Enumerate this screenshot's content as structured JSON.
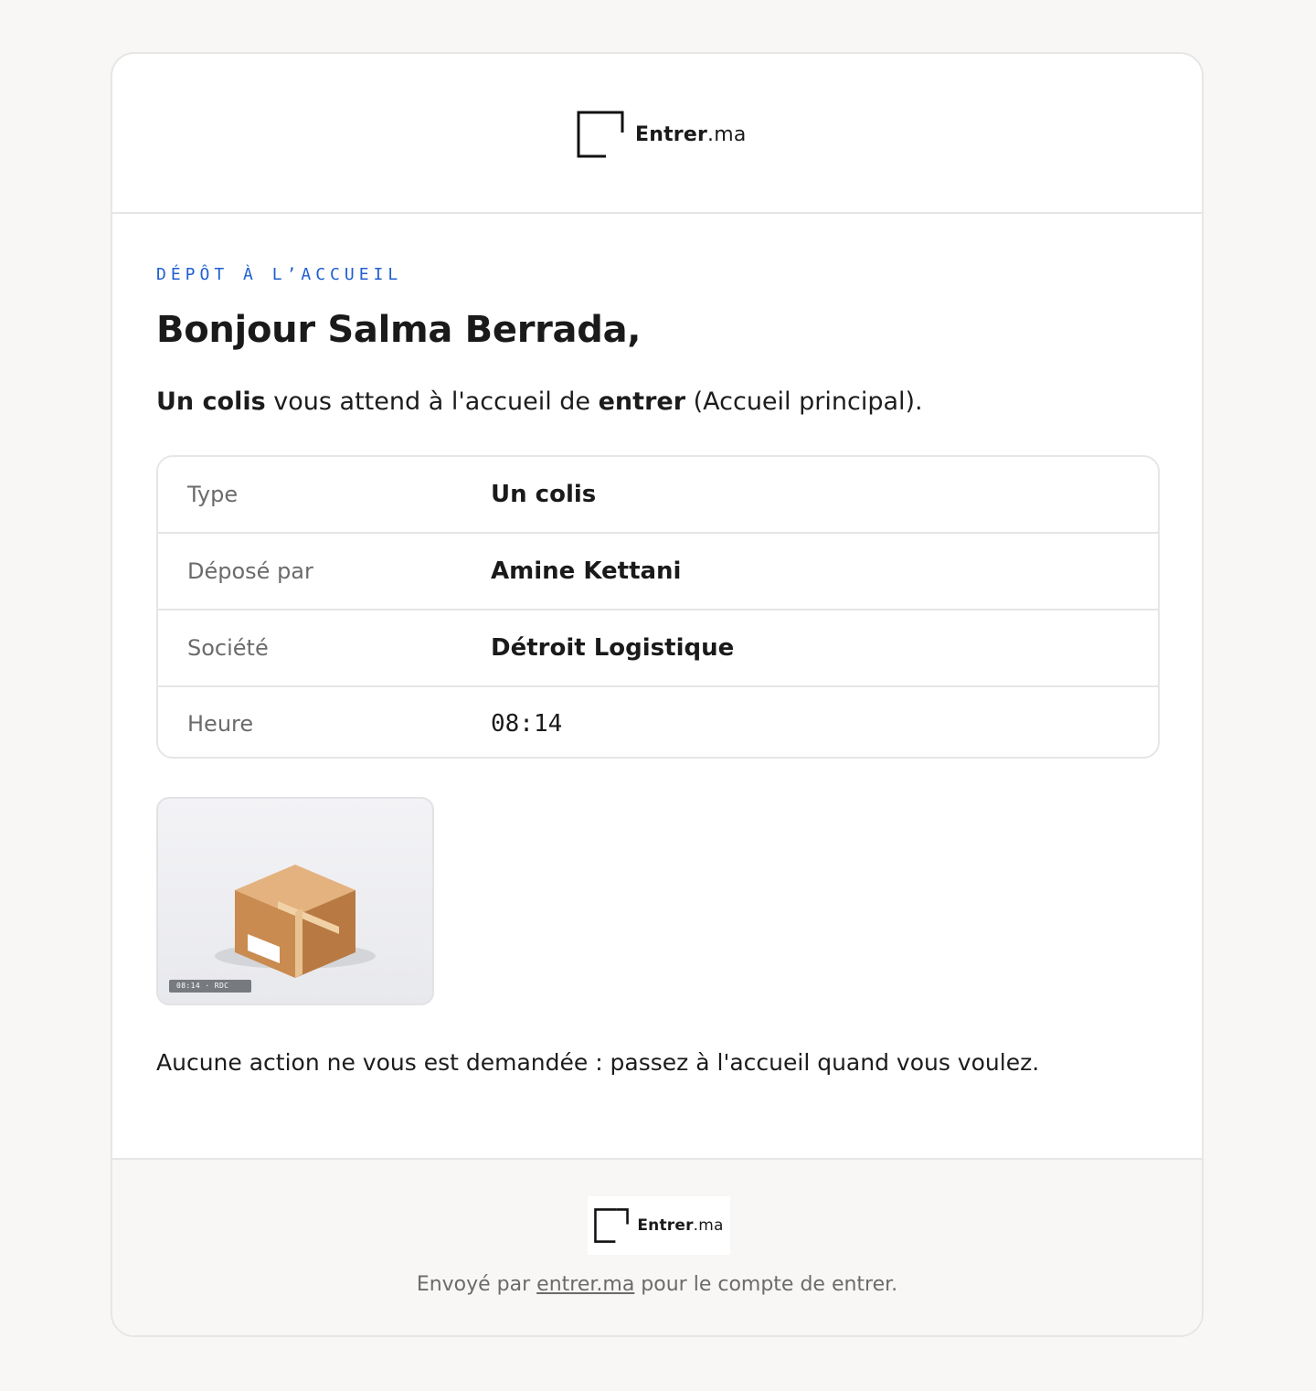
{
  "brand": {
    "name_bold": "Entrer",
    "name_suffix": ".ma"
  },
  "eyebrow": "DÉPÔT À L’ACCUEIL",
  "greeting": "Bonjour Salma Berrada,",
  "intro": {
    "item": "Un colis",
    "middle": " vous attend à l'accueil de ",
    "company": "entrer",
    "location": " (Accueil principal)."
  },
  "details": [
    {
      "label": "Type",
      "value": "Un colis"
    },
    {
      "label": "Déposé par",
      "value": "Amine Kettani"
    },
    {
      "label": "Société",
      "value": "Détroit Logistique"
    },
    {
      "label": "Heure",
      "value": "08:14"
    }
  ],
  "photo": {
    "caption": "08:14 · RDC"
  },
  "note": "Aucune action ne vous est demandée : passez à l'accueil quand vous voulez.",
  "footer": {
    "prefix": "Envoyé par ",
    "link": "entrer.ma",
    "suffix": " pour le compte de entrer."
  },
  "colors": {
    "accent": "#1f5fcf",
    "background": "#f8f7f5",
    "border": "#e6e6e4",
    "box_light": "#e4b27e",
    "box_front": "#c98b4f",
    "box_side": "#b87a42"
  }
}
